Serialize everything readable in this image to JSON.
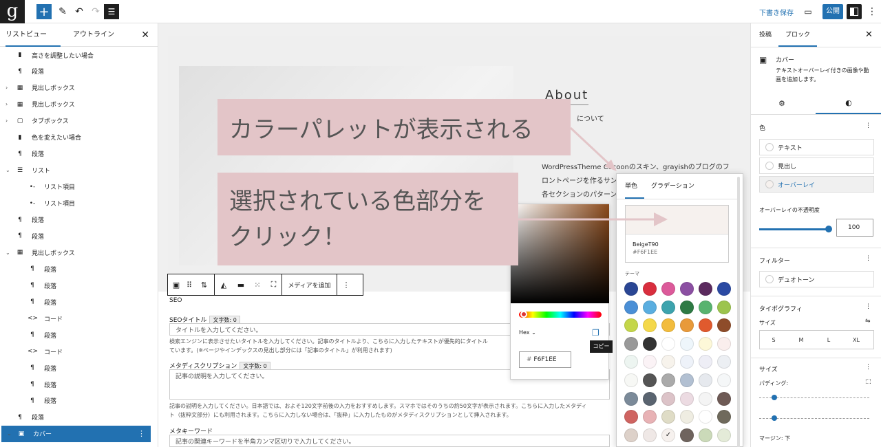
{
  "topbar": {
    "logo": "g",
    "draft_label": "下書き保存",
    "publish_label": "公開"
  },
  "left_panel": {
    "tab_list": "リストビュー",
    "tab_outline": "アウトライン",
    "items": [
      "高さを調整したい場合",
      "段落",
      "見出しボックス",
      "見出しボックス",
      "タブボックス",
      "色を変えたい場合",
      "段落",
      "リスト",
      "リスト項目",
      "リスト項目",
      "段落",
      "段落",
      "見出しボックス",
      "段落",
      "段落",
      "段落",
      "コード",
      "段落",
      "コード",
      "段落",
      "段落",
      "段落",
      "段落",
      "カバー"
    ]
  },
  "canvas": {
    "about_heading": "About",
    "about_sub": "について",
    "about_body": [
      "WordPressTheme Cocoonのスキン、grayishのブログのフ",
      "ロントページを作るサンプルページです。",
      "各セクションのパターンに"
    ],
    "dot_line": "。",
    "block_toolbar": {
      "add_media": "メディアを追加"
    },
    "seo": {
      "section_title": "SEO",
      "title_label": "SEOタイトル",
      "title_count": "文字数: 0",
      "title_placeholder": "タイトルを入力してください。",
      "title_help": "検索エンジンに表示させたいタイトルを入力してください。記事のタイトルより、こちらに入力したテキストが優先的にタイトル",
      "title_help2": "ています。(※ページやインデックスの見出し部分には「記事のタイトル」が利用されます)",
      "meta_label": "メタディスクリプション",
      "meta_count": "文字数: 0",
      "meta_placeholder": "記事の説明を入力してください。",
      "meta_help": "記事の説明を入力してください。日本語では、およそ120文字前後の入力をおすすめします。スマホではそのうちの約50文字が表示されます。こちらに入力したメタディ",
      "meta_help2": "ト（抜粋文部分）にも利用されます。こちらに入力しない場合は、「抜粋」に入力したものがメタディスクリプションとして挿入されます。",
      "kw_label": "メタキーワード",
      "kw_placeholder": "記事の関連キーワードを半角カンマ区切りで入力してください。"
    }
  },
  "right_panel": {
    "tab_post": "投稿",
    "tab_block": "ブロック",
    "block_name": "カバー",
    "block_desc": "テキストオーバーレイ付きの画像や動画を追加します。",
    "color_section": "色",
    "color_text": "テキスト",
    "color_heading": "見出し",
    "color_overlay": "オーバーレイ",
    "opacity_label": "オーバーレイの不透明度",
    "opacity_value": "100",
    "opacity_level": 1.0,
    "filter_section": "フィルター",
    "duotone": "デュオトーン",
    "typo_section": "タイポグラフィ",
    "size_label": "サイズ",
    "sizes": [
      "S",
      "M",
      "L",
      "XL"
    ],
    "size_section": "サイズ",
    "padding_label": "パディング:",
    "margin_label": "マージン: 下"
  },
  "picker": {
    "hex_mode": "Hex",
    "hex_value": "F6F1EE",
    "copy_tooltip": "コピー"
  },
  "palette": {
    "tab_solid": "単色",
    "tab_gradient": "グラデーション",
    "selected_name": "BeigeT90",
    "selected_hex": "#F6F1EE",
    "theme_label": "テーマ",
    "colors": [
      "#2a4694",
      "#d92e3e",
      "#dc5a9a",
      "#8b4fa2",
      "#5b2a5e",
      "#2b4aa3",
      "#4a8fd6",
      "#5aaee0",
      "#3da3ad",
      "#2e7a44",
      "#58b36f",
      "#9cc44e",
      "#c4d64a",
      "#f4d84a",
      "#f2bc3d",
      "#e89a3a",
      "#e05a2e",
      "#8e4c2a",
      "#999999",
      "#333333",
      "#ffffff",
      "#eef6fb",
      "#fdf8d8",
      "#faeeed",
      "#edf5f1",
      "#fbf3f6",
      "#f7f3ec",
      "#eef2f9",
      "#eeeef6",
      "#eceff3",
      "#f7f8f5",
      "#555555",
      "#aaaaaa",
      "#b2c0d2",
      "#e6e9ee",
      "#f5f7f8",
      "#7b8a99",
      "#5a6470",
      "#dcc3c8",
      "#ecdbe2",
      "#f4f4f4",
      "#6e5a55",
      "#cf6461",
      "#e8b2b5",
      "#dfdcc6",
      "#efede2",
      "#ffffff",
      "#6f6a5c",
      "#ddd1c9",
      "#efe8e6",
      "#f6f1ee",
      "#6f645e",
      "#cbdab9",
      "#e4ebd8"
    ],
    "selected_index": 50
  },
  "callouts": {
    "c1": "カラーパレットが表示される",
    "c2": "選択されている色部分を\nクリック！"
  }
}
